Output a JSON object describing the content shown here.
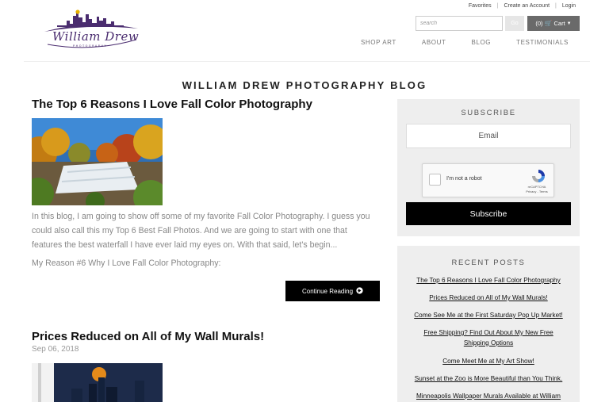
{
  "header": {
    "top_links": [
      "Favorites",
      "Create an Account",
      "Login"
    ],
    "search": {
      "placeholder": "search"
    },
    "go_label": "Go",
    "cart_label": "(0)",
    "cart_suffix": "Cart",
    "nav": [
      "SHOP ART",
      "ABOUT",
      "BLOG",
      "TESTIMONIALS"
    ]
  },
  "blog": {
    "title": "WILLIAM DREW PHOTOGRAPHY BLOG",
    "posts": [
      {
        "title": "The Top 6 Reasons I Love Fall Color Photography",
        "excerpt": "In this blog, I am going to show off some of my favorite Fall Color Photography. I guess you could also call this my Top 6 Best Fall Photos. And we are going to start with one that features the best waterfall I have ever laid my eyes on. With that said, let's begin...",
        "subheading": "My Reason #6 Why I Love Fall Color Photography:",
        "button": "Continue Reading"
      },
      {
        "title": "Prices Reduced on All of My Wall Murals!",
        "date": "Sep 06, 2018"
      }
    ]
  },
  "sidebar": {
    "subscribe": {
      "title": "SUBSCRIBE",
      "email_placeholder": "Email",
      "captcha_text": "I'm not a robot",
      "captcha_brand": "reCAPTCHA",
      "captcha_terms": "Privacy - Terms",
      "button": "Subscribe"
    },
    "recent": {
      "title": "RECENT POSTS",
      "items": [
        "The Top 6 Reasons I Love Fall Color Photography",
        "Prices Reduced on All of My Wall Murals!",
        "Come See Me at the First Saturday Pop Up Market!",
        "Free Shipping? Find Out About My New Free Shipping Options",
        "Come Meet Me at My Art Show!",
        "Sunset at the Zoo is More Beautiful than You Think.",
        "Minneapolis Wallpaper Murals Available at William"
      ]
    }
  },
  "colors": {
    "logo_purple": "#4a2c6f",
    "button_black": "#000000",
    "sidebar_bg": "#eeeeee"
  }
}
